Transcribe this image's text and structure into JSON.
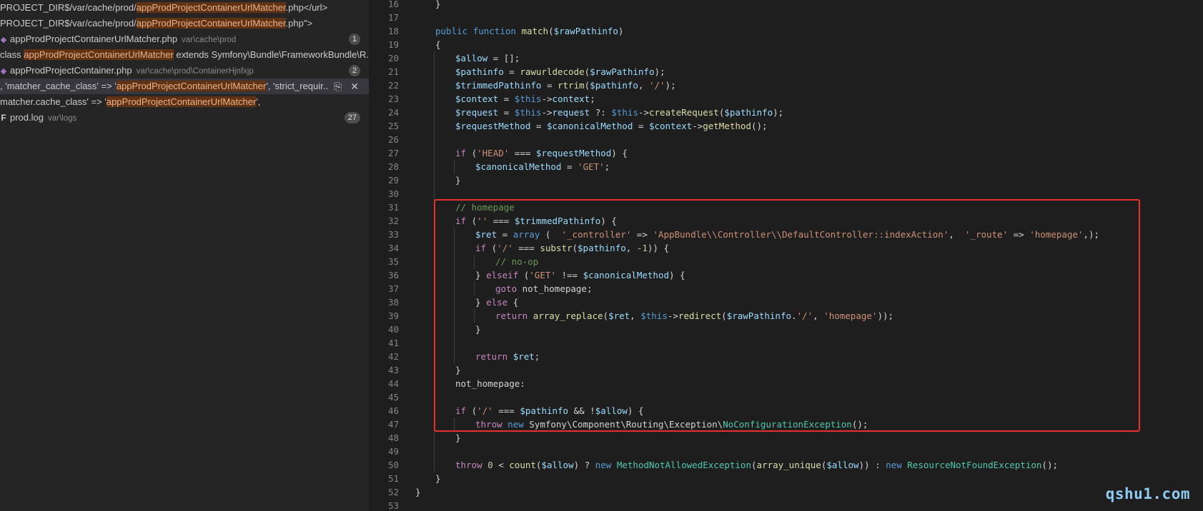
{
  "sidebar": {
    "rows": [
      {
        "kind": "match",
        "parts": [
          "PROJECT_DIR$/var/cache/prod/",
          "appProdProjectContainerUrlMatcher",
          ".php</url>"
        ]
      },
      {
        "kind": "match",
        "parts": [
          "PROJECT_DIR$/var/cache/prod/",
          "appProdProjectContainerUrlMatcher",
          ".php\">"
        ]
      },
      {
        "kind": "file",
        "icon": "php-file-icon",
        "glyph": "◆",
        "name": "appProdProjectContainerUrlMatcher.php",
        "path": "var\\cache\\prod",
        "count": "1"
      },
      {
        "kind": "match",
        "parts": [
          "class ",
          "appProdProjectContainerUrlMatcher",
          " extends Symfony\\Bundle\\FrameworkBundle\\R..."
        ]
      },
      {
        "kind": "file",
        "icon": "php-file-icon",
        "glyph": "◆",
        "name": "appProdProjectContainer.php",
        "path": "var\\cache\\prod\\ContainerHjnfxjp",
        "count": "2"
      },
      {
        "kind": "match",
        "selected": true,
        "parts": [
          ", 'matcher_cache_class' => '",
          "appProdProjectContainerUrlMatcher",
          "', 'strict_requir..."
        ]
      },
      {
        "kind": "match",
        "parts": [
          "matcher.cache_class' => '",
          "appProdProjectContainerUrlMatcher",
          "',"
        ]
      },
      {
        "kind": "file",
        "icon": "log-file-icon",
        "glyph": "F",
        "name": "prod.log",
        "path": "var\\logs",
        "count": "27"
      }
    ],
    "actions": {
      "replace_icon": "replace-icon",
      "dismiss_icon": "close-icon"
    }
  },
  "editor": {
    "lines": [
      {
        "n": "16",
        "indent": 1,
        "html": "}"
      },
      {
        "n": "17",
        "indent": 0,
        "html": ""
      },
      {
        "n": "18",
        "indent": 1,
        "html": "<span class='kw'>public</span> <span class='kw'>function</span> <span class='fn'>match</span>(<span class='var'>$rawPathinfo</span>)"
      },
      {
        "n": "19",
        "indent": 1,
        "html": "{"
      },
      {
        "n": "20",
        "indent": 2,
        "html": "<span class='var'>$allow</span> = [];"
      },
      {
        "n": "21",
        "indent": 2,
        "html": "<span class='var'>$pathinfo</span> = <span class='fn'>rawurldecode</span>(<span class='var'>$rawPathinfo</span>);"
      },
      {
        "n": "22",
        "indent": 2,
        "html": "<span class='var'>$trimmedPathinfo</span> = <span class='fn'>rtrim</span>(<span class='var'>$pathinfo</span>, <span class='str'>'/'</span>);"
      },
      {
        "n": "23",
        "indent": 2,
        "html": "<span class='var'>$context</span> = <span class='kw'>$this</span>-><span class='var'>context</span>;"
      },
      {
        "n": "24",
        "indent": 2,
        "html": "<span class='var'>$request</span> = <span class='kw'>$this</span>-><span class='var'>request</span> ?: <span class='kw'>$this</span>-><span class='fn'>createRequest</span>(<span class='var'>$pathinfo</span>);"
      },
      {
        "n": "25",
        "indent": 2,
        "html": "<span class='var'>$requestMethod</span> = <span class='var'>$canonicalMethod</span> = <span class='var'>$context</span>-><span class='fn'>getMethod</span>();"
      },
      {
        "n": "26",
        "indent": 0,
        "html": ""
      },
      {
        "n": "27",
        "indent": 2,
        "html": "<span class='ctl'>if</span> (<span class='str'>'HEAD'</span> === <span class='var'>$requestMethod</span>) {"
      },
      {
        "n": "28",
        "indent": 3,
        "html": "<span class='var'>$canonicalMethod</span> = <span class='str'>'GET'</span>;"
      },
      {
        "n": "29",
        "indent": 2,
        "html": "}"
      },
      {
        "n": "30",
        "indent": 0,
        "html": ""
      },
      {
        "n": "31",
        "indent": 2,
        "html": "<span class='com'>// homepage</span>"
      },
      {
        "n": "32",
        "indent": 2,
        "html": "<span class='ctl'>if</span> (<span class='str'>''</span> === <span class='var'>$trimmedPathinfo</span>) {"
      },
      {
        "n": "33",
        "indent": 3,
        "html": "<span class='var'>$ret</span> = <span class='kw'>array</span> (  <span class='str'>'_controller'</span> => <span class='str'>'AppBundle\\\\Controller\\\\DefaultController::indexAction'</span>,  <span class='str'>'_route'</span> => <span class='str'>'homepage'</span>,);"
      },
      {
        "n": "34",
        "indent": 3,
        "html": "<span class='ctl'>if</span> (<span class='str'>'/'</span> === <span class='fn'>substr</span>(<span class='var'>$pathinfo</span>, <span class='num'>-1</span>)) {"
      },
      {
        "n": "35",
        "indent": 4,
        "html": "<span class='com'>// no-op</span>"
      },
      {
        "n": "36",
        "indent": 3,
        "html": "} <span class='ctl'>elseif</span> (<span class='str'>'GET'</span> !== <span class='var'>$canonicalMethod</span>) {"
      },
      {
        "n": "37",
        "indent": 4,
        "html": "<span class='ctl'>goto</span> not_homepage;"
      },
      {
        "n": "38",
        "indent": 3,
        "html": "} <span class='ctl'>else</span> {"
      },
      {
        "n": "39",
        "indent": 4,
        "html": "<span class='ctl'>return</span> <span class='fn'>array_replace</span>(<span class='var'>$ret</span>, <span class='kw'>$this</span>-><span class='fn'>redirect</span>(<span class='var'>$rawPathinfo</span>.<span class='str'>'/'</span>, <span class='str'>'homepage'</span>));"
      },
      {
        "n": "40",
        "indent": 3,
        "html": "}"
      },
      {
        "n": "41",
        "indent": 0,
        "html": ""
      },
      {
        "n": "42",
        "indent": 3,
        "html": "<span class='ctl'>return</span> <span class='var'>$ret</span>;"
      },
      {
        "n": "43",
        "indent": 2,
        "html": "}"
      },
      {
        "n": "44",
        "indent": 2,
        "html": "not_homepage:"
      },
      {
        "n": "45",
        "indent": 0,
        "html": ""
      },
      {
        "n": "46",
        "indent": 2,
        "html": "<span class='ctl'>if</span> (<span class='str'>'/'</span> === <span class='var'>$pathinfo</span> && !<span class='var'>$allow</span>) {"
      },
      {
        "n": "47",
        "indent": 3,
        "html": "<span class='ctl'>throw</span> <span class='kw'>new</span> Symfony\\Component\\Routing\\Exception\\<span class='cls'>NoConfigurationException</span>();"
      },
      {
        "n": "48",
        "indent": 2,
        "html": "}"
      },
      {
        "n": "49",
        "indent": 0,
        "html": ""
      },
      {
        "n": "50",
        "indent": 2,
        "html": "<span class='ctl'>throw</span> <span class='num'>0</span> < <span class='fn'>count</span>(<span class='var'>$allow</span>) ? <span class='kw'>new</span> <span class='cls'>MethodNotAllowedException</span>(<span class='fn'>array_unique</span>(<span class='var'>$allow</span>)) : <span class='kw'>new</span> <span class='cls'>ResourceNotFoundException</span>();"
      },
      {
        "n": "51",
        "indent": 1,
        "html": "}"
      },
      {
        "n": "52",
        "indent": 0,
        "html": "}"
      },
      {
        "n": "53",
        "indent": 0,
        "html": ""
      }
    ]
  },
  "watermark": "qshu1.com"
}
